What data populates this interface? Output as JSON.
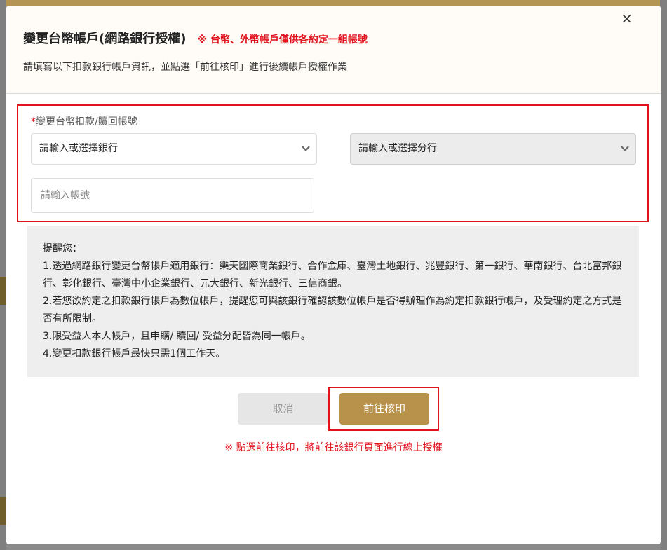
{
  "modal": {
    "close_glyph": "×",
    "title": "變更台幣帳戶(網路銀行授權)",
    "title_note": "※ 台幣、外幣帳戶僅供各約定一組帳號",
    "subtitle": "請填寫以下扣款銀行帳戶資訊，並點選「前往核印」進行後續帳戶授權作業"
  },
  "form": {
    "required_mark": "*",
    "label": "變更台幣扣款/贖回帳號",
    "bank_select": "請輸入或選擇銀行",
    "branch_select": "請輸入或選擇分行",
    "account_placeholder": "請輸入帳號"
  },
  "notice": {
    "heading": "提醒您：",
    "items": [
      "1.透過網路銀行變更台幣帳戶適用銀行：樂天國際商業銀行、合作金庫、臺灣土地銀行、兆豐銀行、第一銀行、華南銀行、台北富邦銀行、彰化銀行、臺灣中小企業銀行、元大銀行、新光銀行、三信商銀。",
      "2.若您欲約定之扣款銀行帳戶為數位帳戶，提醒您可與該銀行確認該數位帳戶是否得辦理作為約定扣款銀行帳戶，及受理約定之方式是否有所限制。",
      "3.限受益人本人帳戶，且申購/ 贖回/ 受益分配皆為同一帳戶。",
      "4.變更扣款銀行帳戶最快只需1個工作天。"
    ]
  },
  "buttons": {
    "cancel": "取消",
    "go": "前往核印"
  },
  "footnote": "※ 點選前往核印，將前往該銀行頁面進行線上授權",
  "colors": {
    "accent_gold": "#b8914a",
    "alert_red": "#e0121c"
  }
}
